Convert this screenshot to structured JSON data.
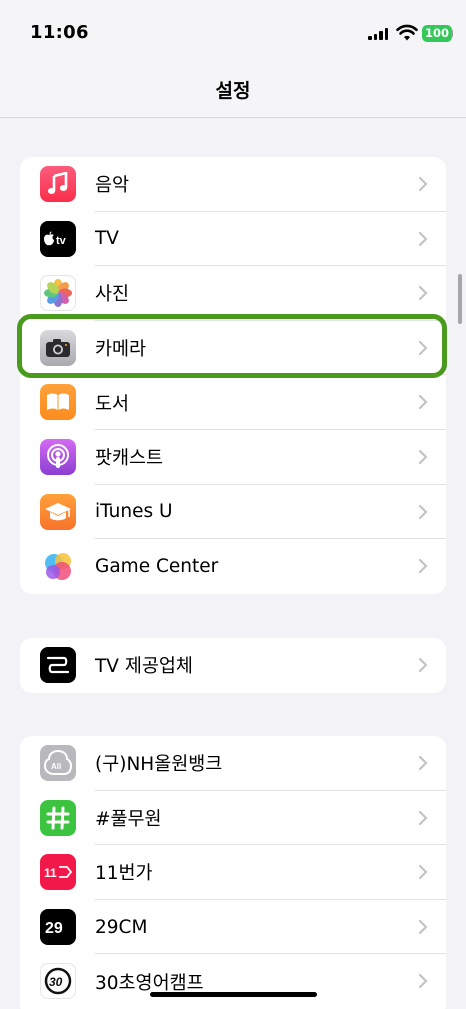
{
  "status_bar": {
    "time": "11:06",
    "battery": "100",
    "battery_color": "#34c759"
  },
  "nav": {
    "title": "설정"
  },
  "groups": [
    {
      "rows": [
        {
          "label": "음악",
          "icon": "music-icon"
        },
        {
          "label": "TV",
          "icon": "apple-tv-icon"
        },
        {
          "label": "사진",
          "icon": "photos-icon"
        },
        {
          "label": "카메라",
          "icon": "camera-icon",
          "highlighted": true
        },
        {
          "label": "도서",
          "icon": "books-icon"
        },
        {
          "label": "팟캐스트",
          "icon": "podcasts-icon"
        },
        {
          "label": "iTunes U",
          "icon": "itunes-u-icon"
        },
        {
          "label": "Game Center",
          "icon": "game-center-icon"
        }
      ]
    },
    {
      "rows": [
        {
          "label": "TV 제공업체",
          "icon": "tv-provider-icon"
        }
      ]
    },
    {
      "rows": [
        {
          "label": "(구)NH올원뱅크",
          "icon": "nh-allone-bank-icon"
        },
        {
          "label": "#풀무원",
          "icon": "pulmuone-icon"
        },
        {
          "label": "11번가",
          "icon": "11st-icon"
        },
        {
          "label": "29CM",
          "icon": "29cm-icon"
        },
        {
          "label": "30초영어캠프",
          "icon": "30sec-english-icon"
        }
      ]
    }
  ],
  "highlight_color": "#4a9a1e"
}
